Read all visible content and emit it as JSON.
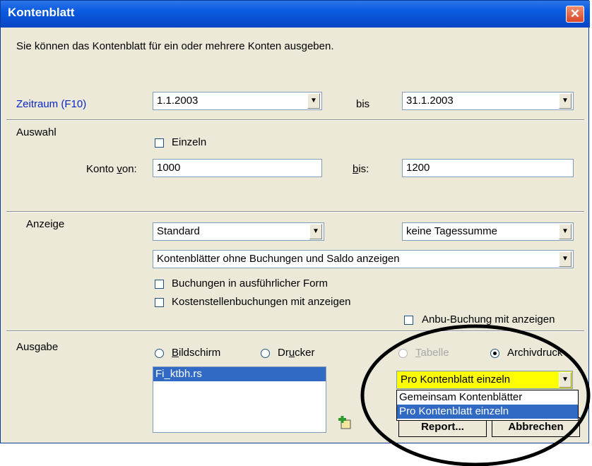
{
  "window": {
    "title": "Kontenblatt",
    "close_symbol": "✕",
    "intro": "Sie können das Kontenblatt für ein oder mehrere Konten ausgeben."
  },
  "zeitraum": {
    "label": "Zeitraum (F10)",
    "from": "1.1.2003",
    "bis_label": "bis",
    "to": "31.1.2003"
  },
  "auswahl": {
    "section_label": "Auswahl",
    "einzeln_label": "Einzeln",
    "einzeln_checked": false,
    "konto_von_label": "Konto von:",
    "konto_von": "1000",
    "bis_label": "bis:",
    "konto_bis": "1200"
  },
  "anzeige": {
    "section_label": "Anzeige",
    "mode": "Standard",
    "tagessumme": "keine Tagessumme",
    "filter": "Kontenblätter ohne Buchungen und Saldo anzeigen",
    "chk_ausfuehrlich": "Buchungen in ausführlicher Form",
    "chk_kostenstellen": "Kostenstellenbuchungen mit anzeigen",
    "chk_anbu": "Anbu-Buchung mit anzeigen"
  },
  "ausgabe": {
    "section_label": "Ausgabe",
    "radio_bildschirm": "Bildschirm",
    "radio_drucker": "Drucker",
    "radio_tabelle": "Tabelle",
    "radio_archiv": "Archivdruck",
    "selected_radio": "Archivdruck",
    "report_file": "Fi_ktbh.rs",
    "archiv_mode": "Pro Kontenblatt einzeln",
    "archiv_options": [
      "Gemeinsam Kontenblätter",
      "Pro Kontenblatt einzeln"
    ],
    "highlight_color": "#ffff00"
  },
  "buttons": {
    "report": "Report...",
    "abbrechen": "Abbrechen"
  }
}
